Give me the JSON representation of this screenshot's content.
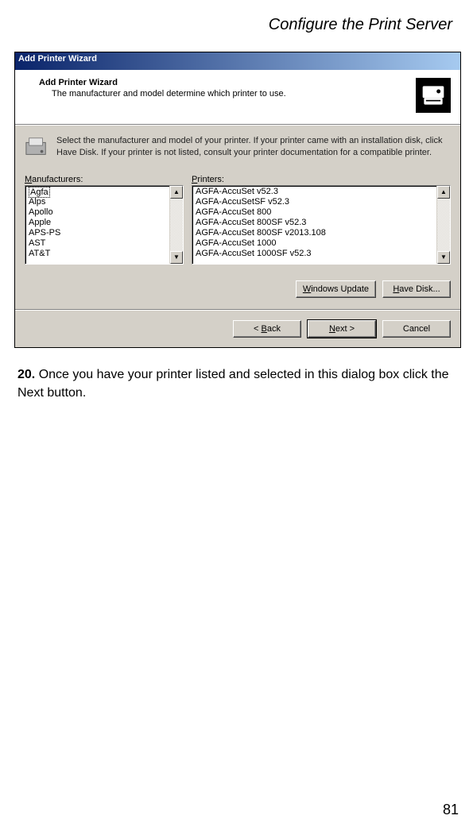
{
  "header": {
    "title": "Configure the Print Server"
  },
  "dialog": {
    "titlebar": "Add Printer Wizard",
    "top": {
      "title": "Add Printer Wizard",
      "subtitle": "The manufacturer and model determine which printer to use."
    },
    "instruction": "Select the manufacturer and model of your printer. If your printer came with an installation disk, click Have Disk. If your printer is not listed, consult your printer documentation for a compatible printer.",
    "labels": {
      "manufacturers_pre": "",
      "manufacturers_ul": "M",
      "manufacturers_post": "anufacturers:",
      "printers_pre": "",
      "printers_ul": "P",
      "printers_post": "rinters:"
    },
    "manufacturers": [
      "Agfa",
      "Alps",
      "Apollo",
      "Apple",
      "APS-PS",
      "AST",
      "AT&T"
    ],
    "printers": [
      "AGFA-AccuSet v52.3",
      "AGFA-AccuSetSF v52.3",
      "AGFA-AccuSet 800",
      "AGFA-AccuSet 800SF v52.3",
      "AGFA-AccuSet 800SF v2013.108",
      "AGFA-AccuSet 1000",
      "AGFA-AccuSet 1000SF v52.3"
    ],
    "buttons": {
      "windows_update_pre": "",
      "windows_update_ul": "W",
      "windows_update_post": "indows Update",
      "have_disk_pre": "",
      "have_disk_ul": "H",
      "have_disk_post": "ave Disk...",
      "back_pre": "< ",
      "back_ul": "B",
      "back_post": "ack",
      "next_pre": "",
      "next_ul": "N",
      "next_post": "ext >",
      "cancel": "Cancel"
    }
  },
  "step": {
    "number": "20.",
    "text": " Once you have your printer listed and selected in this dialog box click the Next button."
  },
  "page_number": "81"
}
